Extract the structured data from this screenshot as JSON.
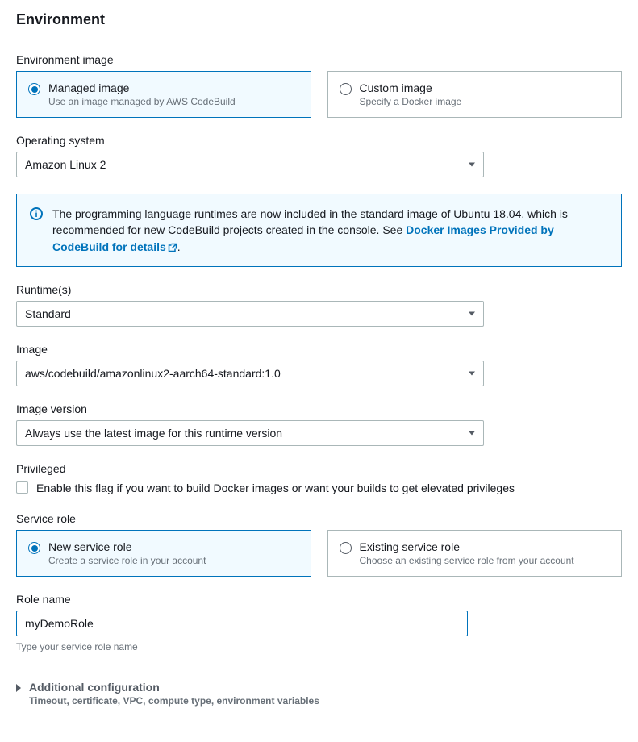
{
  "header": {
    "title": "Environment"
  },
  "env_image": {
    "label": "Environment image",
    "options": [
      {
        "title": "Managed image",
        "desc": "Use an image managed by AWS CodeBuild",
        "selected": true
      },
      {
        "title": "Custom image",
        "desc": "Specify a Docker image",
        "selected": false
      }
    ]
  },
  "os": {
    "label": "Operating system",
    "value": "Amazon Linux 2"
  },
  "info": {
    "text_a": "The programming language runtimes are now included in the standard image of Ubuntu 18.04, which is recommended for new CodeBuild projects created in the console. See ",
    "link": "Docker Images Provided by CodeBuild for details",
    "text_b": "."
  },
  "runtime": {
    "label": "Runtime(s)",
    "value": "Standard"
  },
  "image": {
    "label": "Image",
    "value": "aws/codebuild/amazonlinux2-aarch64-standard:1.0"
  },
  "image_version": {
    "label": "Image version",
    "value": "Always use the latest image for this runtime version"
  },
  "privileged": {
    "label": "Privileged",
    "checkbox_label": "Enable this flag if you want to build Docker images or want your builds to get elevated privileges"
  },
  "service_role": {
    "label": "Service role",
    "options": [
      {
        "title": "New service role",
        "desc": "Create a service role in your account",
        "selected": true
      },
      {
        "title": "Existing service role",
        "desc": "Choose an existing service role from your account",
        "selected": false
      }
    ]
  },
  "role_name": {
    "label": "Role name",
    "value": "myDemoRole",
    "helper": "Type your service role name"
  },
  "additional": {
    "title": "Additional configuration",
    "desc": "Timeout, certificate, VPC, compute type, environment variables"
  }
}
